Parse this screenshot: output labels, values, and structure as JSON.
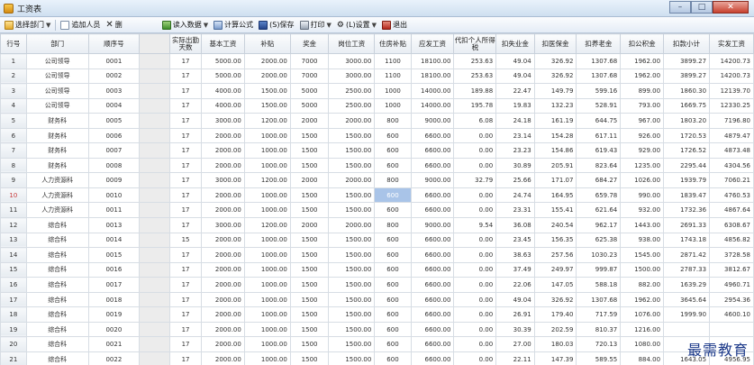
{
  "window": {
    "title": "工资表"
  },
  "toolbar": {
    "items": [
      {
        "label": "选择部门",
        "icon": "folder-icon",
        "dropdown": true
      },
      {
        "label": "追加人员",
        "icon": "page-icon",
        "dropdown": false
      },
      {
        "label": "删",
        "icon": "delete-icon",
        "dropdown": false
      },
      {
        "label": "读入数据",
        "icon": "import-icon",
        "dropdown": true
      },
      {
        "label": "计算公式",
        "icon": "calc-icon",
        "dropdown": false
      },
      {
        "label": "(S)保存",
        "icon": "save-icon",
        "dropdown": false
      },
      {
        "label": "打印",
        "icon": "print-icon",
        "dropdown": true
      },
      {
        "label": "(L)设置",
        "icon": "gear-icon",
        "dropdown": true
      },
      {
        "label": "退出",
        "icon": "exit-icon",
        "dropdown": false
      }
    ]
  },
  "table": {
    "headers": [
      "行号",
      "部门",
      "顺序号",
      "",
      "实际出勤天数",
      "基本工资",
      "补贴",
      "奖金",
      "岗位工资",
      "住房补贴",
      "应发工资",
      "代扣个人所得税",
      "扣失业金",
      "扣医保金",
      "扣养老金",
      "扣公积金",
      "扣款小计",
      "实发工资"
    ],
    "selected_row": 10,
    "highlight_cell": {
      "row": 10,
      "col": 9
    },
    "rows": [
      [
        "1",
        "公司领导",
        "0001",
        "",
        "17",
        "5000.00",
        "2000.00",
        "7000",
        "3000.00",
        "1100",
        "18100.00",
        "253.63",
        "49.04",
        "326.92",
        "1307.68",
        "1962.00",
        "3899.27",
        "14200.73"
      ],
      [
        "2",
        "公司领导",
        "0002",
        "",
        "17",
        "5000.00",
        "2000.00",
        "7000",
        "3000.00",
        "1100",
        "18100.00",
        "253.63",
        "49.04",
        "326.92",
        "1307.68",
        "1962.00",
        "3899.27",
        "14200.73"
      ],
      [
        "3",
        "公司领导",
        "0003",
        "",
        "17",
        "4000.00",
        "1500.00",
        "5000",
        "2500.00",
        "1000",
        "14000.00",
        "189.88",
        "22.47",
        "149.79",
        "599.16",
        "899.00",
        "1860.30",
        "12139.70"
      ],
      [
        "4",
        "公司领导",
        "0004",
        "",
        "17",
        "4000.00",
        "1500.00",
        "5000",
        "2500.00",
        "1000",
        "14000.00",
        "195.78",
        "19.83",
        "132.23",
        "528.91",
        "793.00",
        "1669.75",
        "12330.25"
      ],
      [
        "5",
        "财务科",
        "0005",
        "",
        "17",
        "3000.00",
        "1200.00",
        "2000",
        "2000.00",
        "800",
        "9000.00",
        "6.08",
        "24.18",
        "161.19",
        "644.75",
        "967.00",
        "1803.20",
        "7196.80"
      ],
      [
        "6",
        "财务科",
        "0006",
        "",
        "17",
        "2000.00",
        "1000.00",
        "1500",
        "1500.00",
        "600",
        "6600.00",
        "0.00",
        "23.14",
        "154.28",
        "617.11",
        "926.00",
        "1720.53",
        "4879.47"
      ],
      [
        "7",
        "财务科",
        "0007",
        "",
        "17",
        "2000.00",
        "1000.00",
        "1500",
        "1500.00",
        "600",
        "6600.00",
        "0.00",
        "23.23",
        "154.86",
        "619.43",
        "929.00",
        "1726.52",
        "4873.48"
      ],
      [
        "8",
        "财务科",
        "0008",
        "",
        "17",
        "2000.00",
        "1000.00",
        "1500",
        "1500.00",
        "600",
        "6600.00",
        "0.00",
        "30.89",
        "205.91",
        "823.64",
        "1235.00",
        "2295.44",
        "4304.56"
      ],
      [
        "9",
        "人力资源科",
        "0009",
        "",
        "17",
        "3000.00",
        "1200.00",
        "2000",
        "2000.00",
        "800",
        "9000.00",
        "32.79",
        "25.66",
        "171.07",
        "684.27",
        "1026.00",
        "1939.79",
        "7060.21"
      ],
      [
        "10",
        "人力资源科",
        "0010",
        "",
        "17",
        "2000.00",
        "1000.00",
        "1500",
        "1500.00",
        "600",
        "6600.00",
        "0.00",
        "24.74",
        "164.95",
        "659.78",
        "990.00",
        "1839.47",
        "4760.53"
      ],
      [
        "11",
        "人力资源科",
        "0011",
        "",
        "17",
        "2000.00",
        "1000.00",
        "1500",
        "1500.00",
        "600",
        "6600.00",
        "0.00",
        "23.31",
        "155.41",
        "621.64",
        "932.00",
        "1732.36",
        "4867.64"
      ],
      [
        "12",
        "综合科",
        "0013",
        "",
        "17",
        "3000.00",
        "1200.00",
        "2000",
        "2000.00",
        "800",
        "9000.00",
        "9.54",
        "36.08",
        "240.54",
        "962.17",
        "1443.00",
        "2691.33",
        "6308.67"
      ],
      [
        "13",
        "综合科",
        "0014",
        "",
        "15",
        "2000.00",
        "1000.00",
        "1500",
        "1500.00",
        "600",
        "6600.00",
        "0.00",
        "23.45",
        "156.35",
        "625.38",
        "938.00",
        "1743.18",
        "4856.82"
      ],
      [
        "14",
        "综合科",
        "0015",
        "",
        "17",
        "2000.00",
        "1000.00",
        "1500",
        "1500.00",
        "600",
        "6600.00",
        "0.00",
        "38.63",
        "257.56",
        "1030.23",
        "1545.00",
        "2871.42",
        "3728.58"
      ],
      [
        "15",
        "综合科",
        "0016",
        "",
        "17",
        "2000.00",
        "1000.00",
        "1500",
        "1500.00",
        "600",
        "6600.00",
        "0.00",
        "37.49",
        "249.97",
        "999.87",
        "1500.00",
        "2787.33",
        "3812.67"
      ],
      [
        "16",
        "综合科",
        "0017",
        "",
        "17",
        "2000.00",
        "1000.00",
        "1500",
        "1500.00",
        "600",
        "6600.00",
        "0.00",
        "22.06",
        "147.05",
        "588.18",
        "882.00",
        "1639.29",
        "4960.71"
      ],
      [
        "17",
        "综合科",
        "0018",
        "",
        "17",
        "2000.00",
        "1000.00",
        "1500",
        "1500.00",
        "600",
        "6600.00",
        "0.00",
        "49.04",
        "326.92",
        "1307.68",
        "1962.00",
        "3645.64",
        "2954.36"
      ],
      [
        "18",
        "综合科",
        "0019",
        "",
        "17",
        "2000.00",
        "1000.00",
        "1500",
        "1500.00",
        "600",
        "6600.00",
        "0.00",
        "26.91",
        "179.40",
        "717.59",
        "1076.00",
        "1999.90",
        "4600.10"
      ],
      [
        "19",
        "综合科",
        "0020",
        "",
        "17",
        "2000.00",
        "1000.00",
        "1500",
        "1500.00",
        "600",
        "6600.00",
        "0.00",
        "30.39",
        "202.59",
        "810.37",
        "1216.00",
        "",
        ""
      ],
      [
        "20",
        "综合科",
        "0021",
        "",
        "17",
        "2000.00",
        "1000.00",
        "1500",
        "1500.00",
        "600",
        "6600.00",
        "0.00",
        "27.00",
        "180.03",
        "720.13",
        "1080.00",
        "",
        ""
      ],
      [
        "21",
        "综合科",
        "0022",
        "",
        "17",
        "2000.00",
        "1000.00",
        "1500",
        "1500.00",
        "600",
        "6600.00",
        "0.00",
        "22.11",
        "147.39",
        "589.55",
        "884.00",
        "1643.05",
        "4956.95"
      ]
    ]
  },
  "watermark": "最需教育"
}
